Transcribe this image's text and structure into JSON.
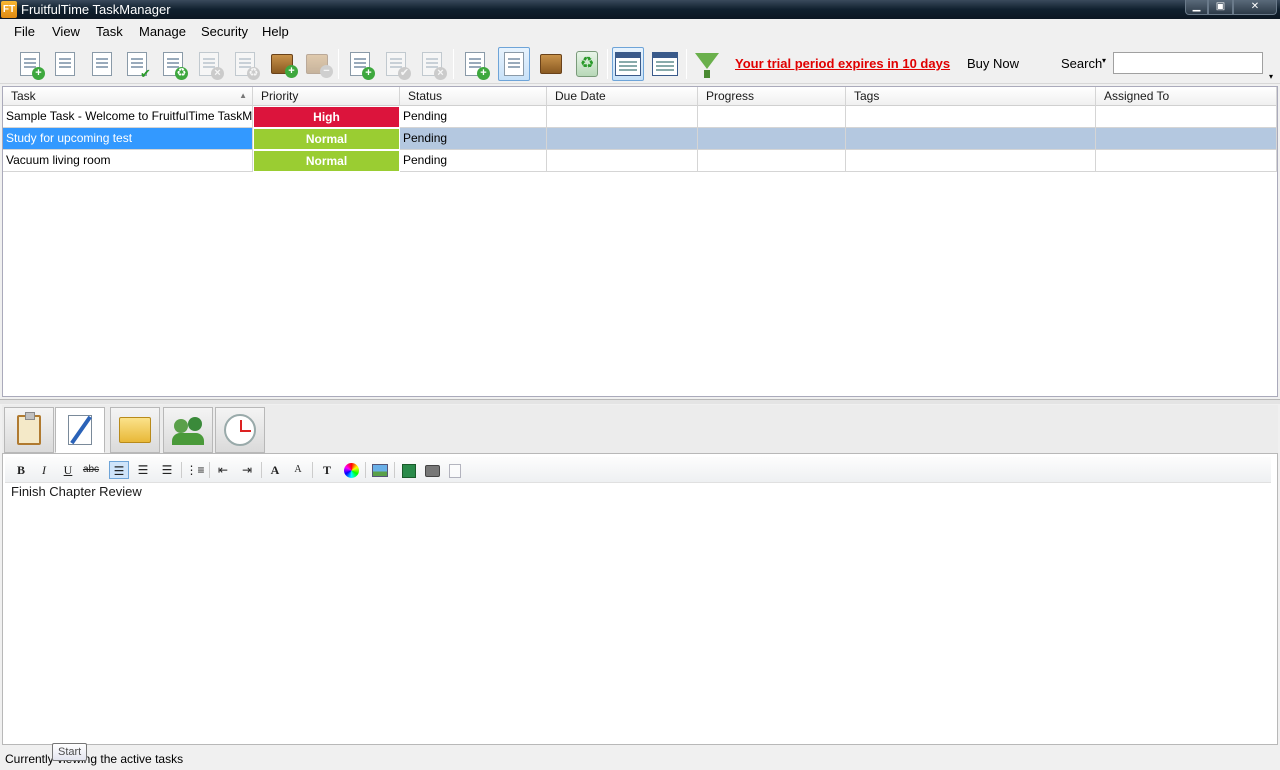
{
  "window": {
    "title": "FruitfulTime TaskManager",
    "logo_text": "FT",
    "min_glyph": "▁",
    "max_glyph": "▣",
    "close_glyph": "✕"
  },
  "menu": [
    "File",
    "View",
    "Task",
    "Manage",
    "Security",
    "Help"
  ],
  "toolbar": {
    "trial_message": "Your trial period expires in 10 days",
    "buy_now": "Buy Now",
    "search_label": "Search",
    "search_value": "",
    "dropdown_glyph": "▾"
  },
  "grid": {
    "columns": [
      "Task",
      "Priority",
      "Status",
      "Due Date",
      "Progress",
      "Tags",
      "Assigned To"
    ],
    "sort_glyph": "▲",
    "rows": [
      {
        "task": "Sample Task - Welcome to FruitfulTime TaskMan...",
        "priority": "High",
        "priority_color": "#dc143c",
        "status": "Pending",
        "due": "",
        "progress": "",
        "tags": "",
        "assigned": ""
      },
      {
        "task": "Study for upcoming test",
        "priority": "Normal",
        "priority_color": "#9acd32",
        "status": "Pending",
        "due": "",
        "progress": "",
        "tags": "",
        "assigned": ""
      },
      {
        "task": "Vacuum living room",
        "priority": "Normal",
        "priority_color": "#9acd32",
        "status": "Pending",
        "due": "",
        "progress": "",
        "tags": "",
        "assigned": ""
      }
    ]
  },
  "format_bar": {
    "bold": "B",
    "italic": "I",
    "underline": "U",
    "strike": "abc",
    "grow": "A",
    "shrink": "A"
  },
  "notes": {
    "text": "Finish Chapter Review"
  },
  "status": {
    "text": "Currently viewing the active tasks",
    "tooltip": "Start"
  }
}
